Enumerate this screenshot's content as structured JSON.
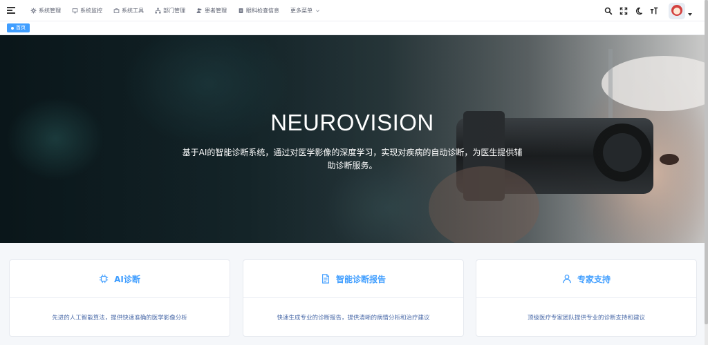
{
  "navbar": {
    "menu": [
      {
        "label": "系统管理",
        "icon": "gear-icon"
      },
      {
        "label": "系统监控",
        "icon": "monitor-icon"
      },
      {
        "label": "系统工具",
        "icon": "tool-icon"
      },
      {
        "label": "部门管理",
        "icon": "tree-icon"
      },
      {
        "label": "患者管理",
        "icon": "users-icon"
      },
      {
        "label": "眼科检查信息",
        "icon": "document-icon"
      },
      {
        "label": "更多菜单",
        "icon": "chevron-down-icon"
      }
    ],
    "right_icons": [
      "search-icon",
      "fullscreen-icon",
      "moon-icon",
      "font-size-icon"
    ],
    "avatar": "avatar"
  },
  "tags": {
    "active": "首页"
  },
  "hero": {
    "title": "NEUROVISION",
    "subtitle": "基于AI的智能诊断系统，通过对医学影像的深度学习，实现对疾病的自动诊断，为医生提供辅助诊断服务。"
  },
  "cards": [
    {
      "title": "AI诊断",
      "icon": "chip-icon",
      "desc": "先进的人工智能算法，提供快速准确的医学影像分析"
    },
    {
      "title": "智能诊断报告",
      "icon": "document-icon",
      "desc": "快速生成专业的诊断报告，提供清晰的病情分析和治疗建议"
    },
    {
      "title": "专家支持",
      "icon": "user-icon",
      "desc": "顶级医疗专家团队提供专业的诊断支持和建议"
    }
  ],
  "colors": {
    "accent": "#409eff",
    "card_text": "#4a6aa8"
  }
}
